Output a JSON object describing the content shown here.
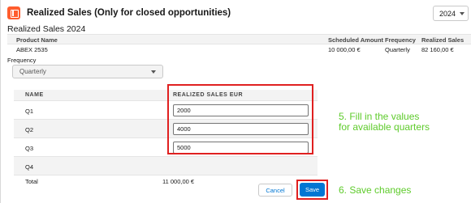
{
  "header": {
    "title": "Realized Sales (Only for closed opportunities)",
    "year": "2024"
  },
  "section": {
    "title": "Realized Sales 2024"
  },
  "summary": {
    "columns": [
      "Product Name",
      "Scheduled Amount",
      "Frequency",
      "Realized Sales"
    ],
    "row": [
      "ABEX 2535",
      "10 000,00 €",
      "Quarterly",
      "82 160,00 €"
    ]
  },
  "frequency": {
    "label": "Frequency",
    "value": "Quarterly"
  },
  "quarters": {
    "headers": [
      "NAME",
      "REALIZED SALES EUR"
    ],
    "rows": [
      {
        "name": "Q1",
        "value": "2000"
      },
      {
        "name": "Q2",
        "value": "4000"
      },
      {
        "name": "Q3",
        "value": "5000"
      },
      {
        "name": "Q4",
        "value": ""
      }
    ],
    "total_label": "Total",
    "total_value": "11 000,00 €"
  },
  "annotations": {
    "step5_line1": "5. Fill in the values",
    "step5_line2": "for available quarters",
    "step6": "6. Save changes"
  },
  "buttons": {
    "cancel": "Cancel",
    "save": "Save"
  },
  "colors": {
    "accent": "#0176d3",
    "highlight": "#e02020",
    "annotation": "#5ecb2b",
    "header_icon": "#ff5d2d"
  }
}
